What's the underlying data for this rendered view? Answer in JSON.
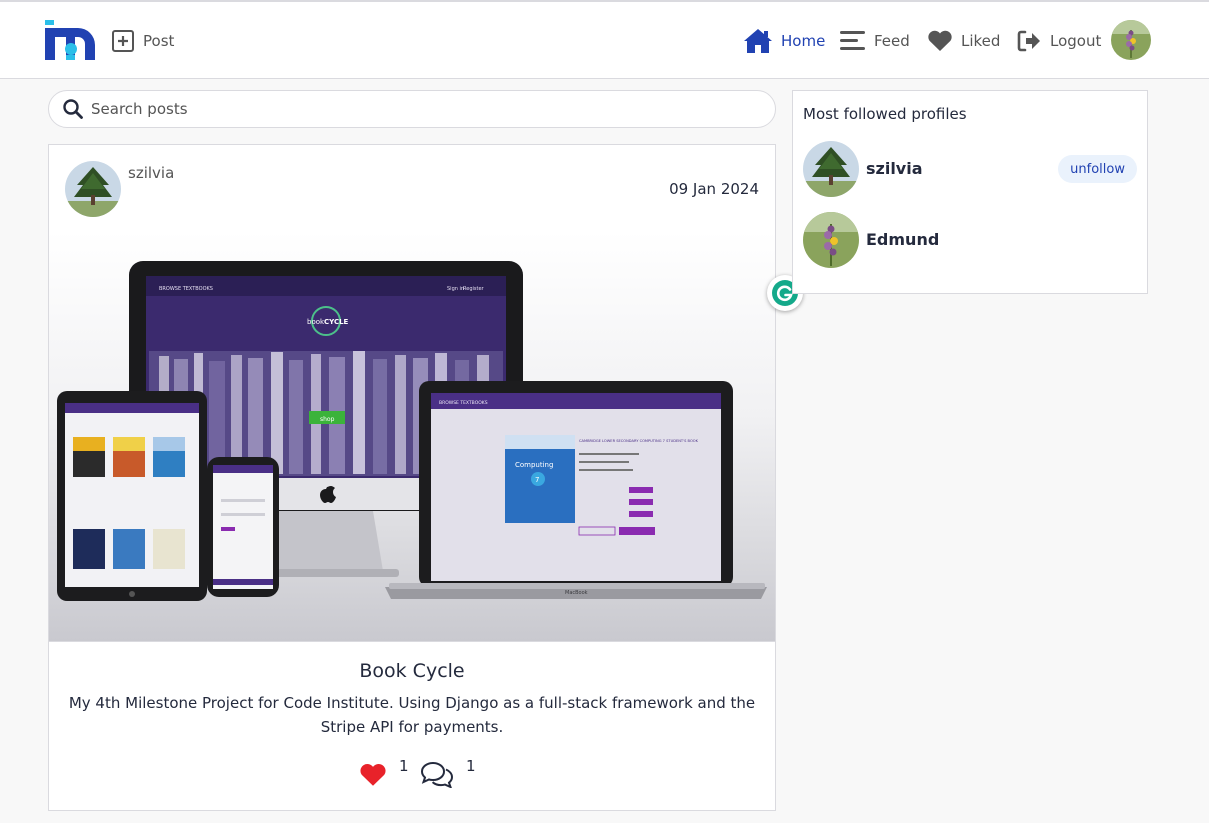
{
  "nav": {
    "post_label": "Post",
    "home_label": "Home",
    "feed_label": "Feed",
    "liked_label": "Liked",
    "logout_label": "Logout"
  },
  "search": {
    "placeholder": "Search posts"
  },
  "post": {
    "owner": "szilvia",
    "date": "09 Jan 2024",
    "title": "Book Cycle",
    "content": "My 4th Milestone Project for Code Institute. Using Django as a full-stack framework and the Stripe API for payments.",
    "likes_count": "1",
    "comments_count": "1",
    "image_texts": {
      "browse": "BROWSE TEXTBOOKS",
      "signin": "Sign in",
      "register": "Register",
      "logo_book": "book",
      "logo_cycle": "CYCLE",
      "shop": "shop",
      "book_title": "CAMBRIDGE LOWER SECONDARY COMPUTING 7 STUDENT'S BOOK",
      "computing": "Computing",
      "seven": "7",
      "macbook": "MacBook"
    }
  },
  "profiles": {
    "title": "Most followed profiles",
    "items": [
      {
        "name": "szilvia",
        "button": "unfollow"
      },
      {
        "name": "Edmund"
      }
    ]
  },
  "colors": {
    "brand_blue": "#2142b2",
    "logo_cyan": "#2bbfe9",
    "like_red": "#e8222a",
    "site_purple": "#5d3a9b"
  },
  "icons": [
    "plus-square-icon",
    "home-icon",
    "bars-icon",
    "heart-icon",
    "logout-icon",
    "search-icon",
    "comments-icon",
    "grammarly-icon"
  ]
}
